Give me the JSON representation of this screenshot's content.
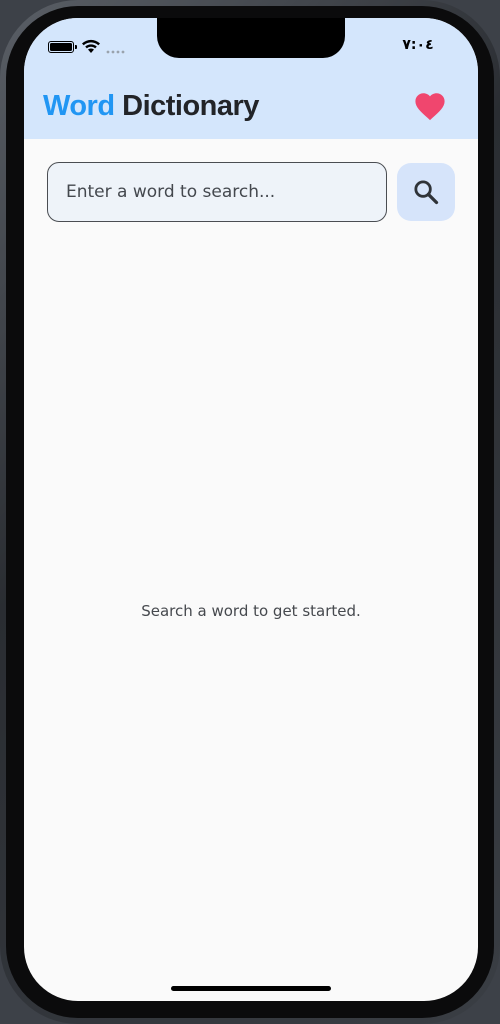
{
  "status_bar": {
    "time": "٧:٠٤",
    "battery_icon": "battery-icon",
    "wifi_icon": "wifi-icon",
    "signal_icon": "cellular-signal-icon"
  },
  "app_bar": {
    "title_part1": "Word",
    "title_part2": " Dictionary",
    "title_part1_color": "#2196f3",
    "title_part2_color": "#222428",
    "background_color": "#d4e6fc",
    "favorites_icon": "heart-icon",
    "favorites_icon_color": "#f0466e"
  },
  "search": {
    "placeholder": "Enter a word to search...",
    "value": "",
    "button_icon": "search-icon"
  },
  "content": {
    "empty_state_text": "Search a word to get started."
  }
}
